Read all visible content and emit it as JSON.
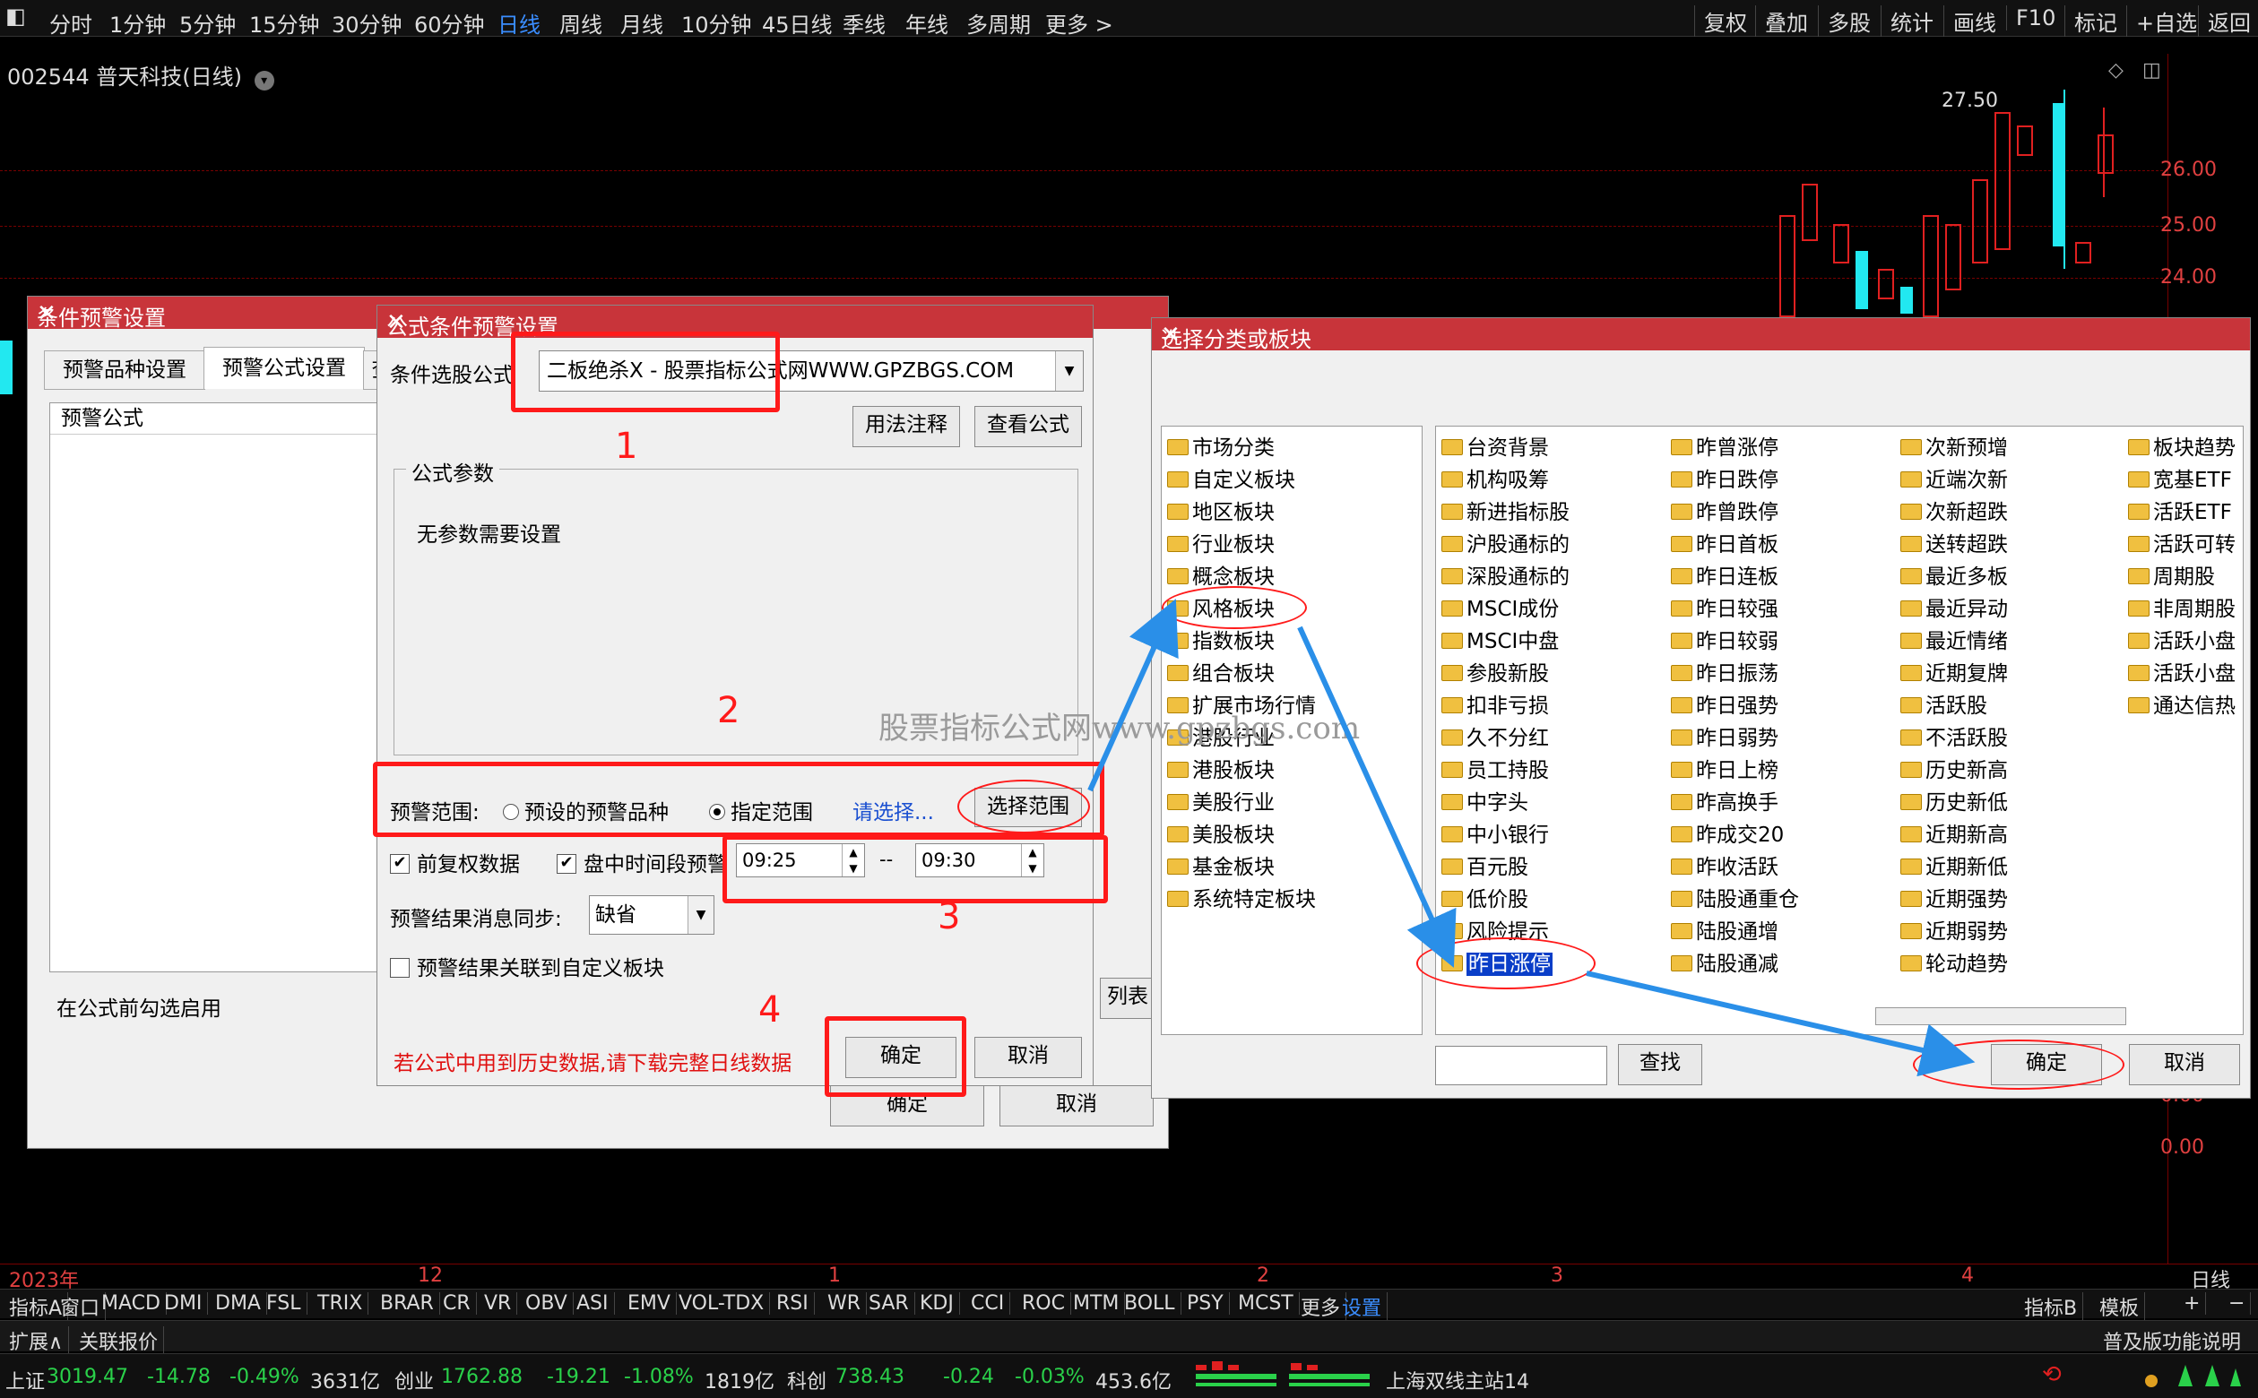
{
  "toolbar": {
    "timeframes": [
      "分时",
      "1分钟",
      "5分钟",
      "15分钟",
      "30分钟",
      "60分钟",
      "日线",
      "周线",
      "月线",
      "10分钟",
      "45日线",
      "季线",
      "年线",
      "多周期",
      "更多 >"
    ],
    "active_timeframe": "日线",
    "right_tools": [
      "复权",
      "叠加",
      "多股",
      "统计",
      "画线",
      "F10",
      "标记",
      "+自选",
      "返回"
    ]
  },
  "chart": {
    "stock_title": "002544 普天科技(日线)",
    "high_label": "27.50",
    "price_labels": [
      "26.00",
      "25.00",
      "24.00"
    ],
    "lower_values": [
      "0.00",
      "0.00"
    ],
    "time_axis": [
      "2023年",
      "12",
      "1",
      "2",
      "3",
      "4"
    ],
    "period_label": "日线"
  },
  "indicators": {
    "items": [
      "指标A",
      "窗口",
      "MACD",
      "DMI",
      "DMA",
      "FSL",
      "TRIX",
      "BRAR",
      "CR",
      "VR",
      "OBV",
      "ASI",
      "EMV",
      "VOL-TDX",
      "RSI",
      "WR",
      "SAR",
      "KDJ",
      "CCI",
      "ROC",
      "MTM",
      "BOLL",
      "PSY",
      "MCST",
      "更多",
      "设置"
    ],
    "right_items": [
      "指标B",
      "模板",
      "+",
      "−"
    ]
  },
  "extension_bar": {
    "left": [
      "扩展∧",
      "关联报价"
    ],
    "right": "普及版功能说明"
  },
  "status_bar": {
    "sh_label": "上证",
    "sh_value": "3019.47",
    "sh_change": "-14.78",
    "sh_pct": "-0.49%",
    "sh_amount": "3631亿",
    "cy_label": "创业",
    "cy_value": "1762.88",
    "cy_change": "-19.21",
    "cy_pct": "-1.08%",
    "cy_amount": "1819亿",
    "kc_label": "科创",
    "kc_value": "738.43",
    "kc_change": "-0.24",
    "kc_pct": "-0.03%",
    "kc_amount": "453.6亿",
    "server": "上海双线主站14"
  },
  "alert_dialog": {
    "title": "条件预警设置",
    "tabs": [
      "预警品种设置",
      "预警公式设置",
      "查"
    ],
    "list_header": "预警公式",
    "footer_text": "在公式前勾选启用",
    "ok": "确定",
    "cancel": "取消",
    "list_btn": "列表"
  },
  "formula_dialog": {
    "title": "公式条件预警设置",
    "formula_label": "条件选股公式",
    "formula_value": "二板绝杀X  -  股票指标公式网WWW.GPZBGS.COM",
    "usage_btn": "用法注释",
    "view_btn": "查看公式",
    "params_group": "公式参数",
    "params_text": "无参数需要设置",
    "scope_label": "预警范围:",
    "scope_opt1": "预设的预警品种",
    "scope_opt2": "指定范围",
    "scope_link": "请选择...",
    "scope_btn": "选择范围",
    "fq_label": "前复权数据",
    "intraday_label": "盘中时间段预警",
    "time_start": "09:25",
    "time_sep": "--",
    "time_end": "09:30",
    "sync_label": "预警结果消息同步:",
    "sync_value": "缺省",
    "link_label": "预警结果关联到自定义板块",
    "warning": "若公式中用到历史数据,请下载完整日线数据",
    "ok": "确定",
    "cancel": "取消"
  },
  "category_dialog": {
    "title": "选择分类或板块",
    "left_items": [
      "市场分类",
      "自定义板块",
      "地区板块",
      "行业板块",
      "概念板块",
      "风格板块",
      "指数板块",
      "组合板块",
      "扩展市场行情",
      "港股行业",
      "港股板块",
      "美股行业",
      "美股板块",
      "基金板块",
      "系统特定板块"
    ],
    "col1": [
      "台资背景",
      "机构吸筹",
      "新进指标股",
      "沪股通标的",
      "深股通标的",
      "MSCI成份",
      "MSCI中盘",
      "参股新股",
      "扣非亏损",
      "久不分红",
      "员工持股",
      "中字头",
      "中小银行",
      "百元股",
      "低价股",
      "风险提示",
      "昨日涨停"
    ],
    "col2": [
      "昨曾涨停",
      "昨日跌停",
      "昨曾跌停",
      "昨日首板",
      "昨日连板",
      "昨日较强",
      "昨日较弱",
      "昨日振荡",
      "昨日强势",
      "昨日弱势",
      "昨日上榜",
      "昨高换手",
      "昨成交20",
      "昨收活跃",
      "陆股通重仓",
      "陆股通增",
      "陆股通减"
    ],
    "col3": [
      "次新预增",
      "近端次新",
      "次新超跌",
      "送转超跌",
      "最近多板",
      "最近异动",
      "最近情绪",
      "近期复牌",
      "活跃股",
      "不活跃股",
      "历史新高",
      "历史新低",
      "近期新高",
      "近期新低",
      "近期强势",
      "近期弱势",
      "轮动趋势"
    ],
    "col4": [
      "板块趋势",
      "宽基ETF",
      "活跃ETF",
      "活跃可转",
      "周期股",
      "非周期股",
      "活跃小盘",
      "活跃小盘",
      "通达信热"
    ],
    "selected": "昨日涨停",
    "find_btn": "查找",
    "ok": "确定",
    "cancel": "取消"
  },
  "annotations": {
    "num1": "1",
    "num2": "2",
    "num3": "3",
    "num4": "4"
  },
  "watermark": "股票指标公式网www.gpzbgs.com",
  "colors": {
    "title_red": "#c8343a",
    "annotation_red": "#ff1a1a",
    "arrow_blue": "#2a8fe8",
    "candle_red": "#e02020",
    "candle_cyan": "#22e8f0"
  }
}
